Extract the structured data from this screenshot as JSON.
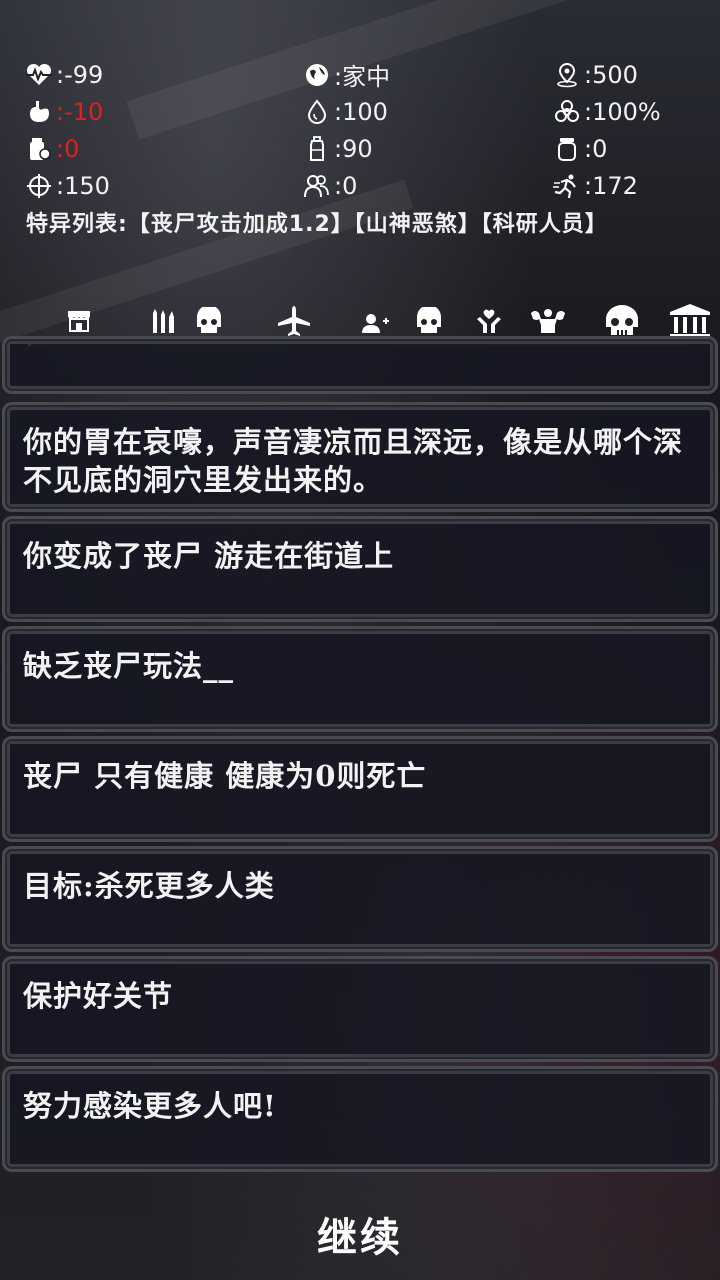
{
  "stats": [
    [
      {
        "icon": "heartbeat-icon",
        "value": ":-99",
        "color": "#ffffff"
      },
      {
        "icon": "globe-icon",
        "value": ":家中",
        "color": "#ffffff"
      },
      {
        "icon": "location-pin-icon",
        "value": ":500",
        "color": "#ffffff"
      }
    ],
    [
      {
        "icon": "stomach-icon",
        "value": ":-10",
        "color": "#e0201c"
      },
      {
        "icon": "water-drop-icon",
        "value": ":100",
        "color": "#ffffff"
      },
      {
        "icon": "biohazard-icon",
        "value": ":100%",
        "color": "#ffffff"
      }
    ],
    [
      {
        "icon": "food-bag-icon",
        "value": ":0",
        "color": "#e0201c"
      },
      {
        "icon": "bottle-icon",
        "value": ":90",
        "color": "#ffffff"
      },
      {
        "icon": "jar-icon",
        "value": ":0",
        "color": "#ffffff"
      }
    ],
    [
      {
        "icon": "crosshair-icon",
        "value": ":150",
        "color": "#ffffff"
      },
      {
        "icon": "people-icon",
        "value": ":0",
        "color": "#ffffff"
      },
      {
        "icon": "running-man-icon",
        "value": ":172",
        "color": "#ffffff"
      }
    ]
  ],
  "traits_text": "特异列表:【丧尸攻击加成1.2】【山神恶煞】【科研人员】",
  "tabs": [
    "shop-icon",
    "weapons-skull-icon",
    "airplane-icon",
    "add-user-skull-icon",
    "heal-hands-icon",
    "muscle-icon",
    "skull-icon",
    "bank-icon"
  ],
  "messages": [
    "",
    "你的胃在哀嚎，声音凄凉而且深远，像是从哪个深不见底的洞穴里发出来的。",
    "你变成了丧尸 游走在街道上",
    "缺乏丧尸玩法__",
    "丧尸 只有健康 健康为0则死亡",
    "目标:杀死更多人类",
    "保护好关节",
    "努力感染更多人吧!"
  ],
  "continue_label": "继续"
}
